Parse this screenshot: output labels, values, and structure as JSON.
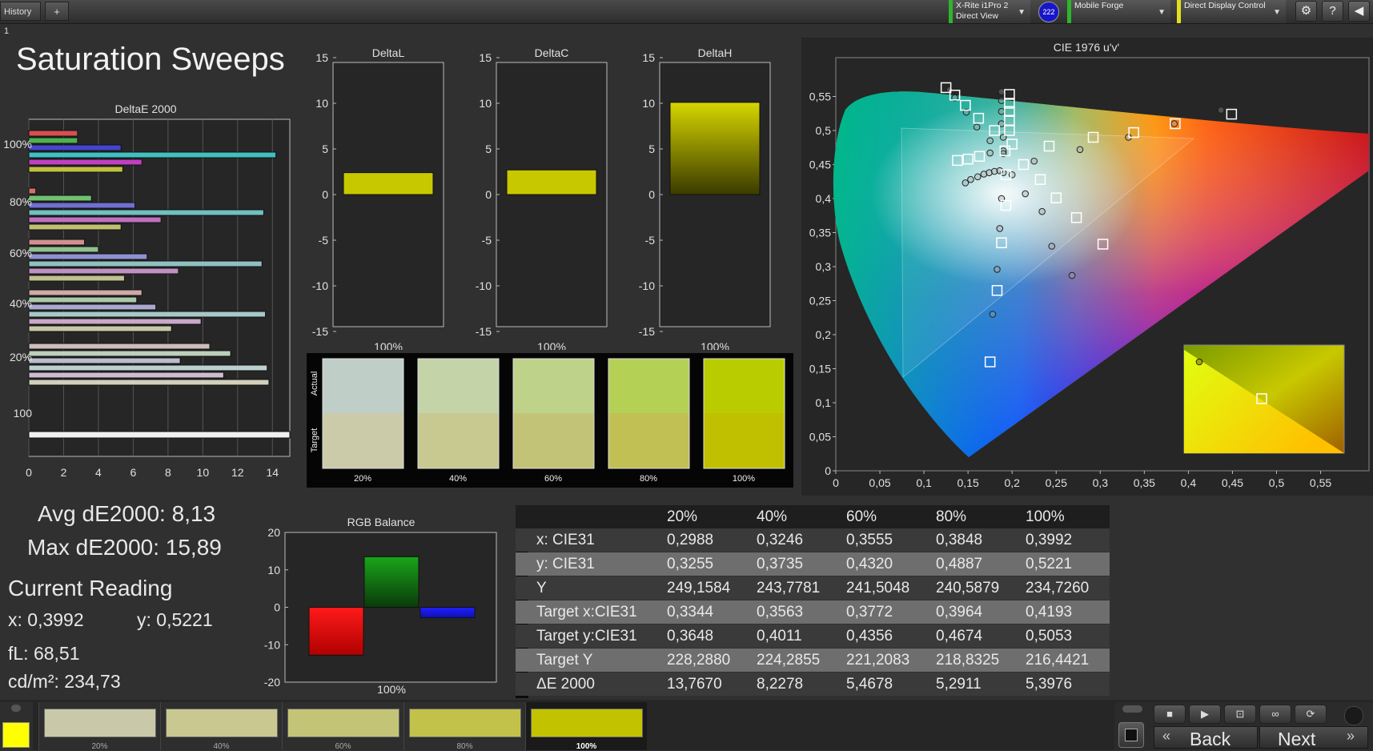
{
  "topbar": {
    "tab_label": "History 1",
    "add_tab": "+",
    "device1_line1": "X-Rite i1Pro 2",
    "device1_line2": "Direct View",
    "badge": "222",
    "device2": "Mobile Forge",
    "device3": "Direct Display Control",
    "icons": [
      "gear-icon",
      "help-icon",
      "back-icon"
    ]
  },
  "page_title": "Saturation Sweeps",
  "deltae_chart": {
    "title": "DeltaE 2000",
    "y_labels": [
      "100%",
      "80%",
      "60%",
      "40%",
      "20%",
      "100"
    ],
    "x_ticks": [
      "0",
      "2",
      "4",
      "6",
      "8",
      "10",
      "12",
      "14"
    ],
    "xlim": [
      0,
      15
    ],
    "groups": [
      {
        "label": "100%",
        "values": [
          2.8,
          2.8,
          5.3,
          14.2,
          6.5,
          5.4
        ],
        "colors": [
          "#d65050",
          "#4fb04f",
          "#4545d0",
          "#40c0c0",
          "#c040c0",
          "#c0c040"
        ]
      },
      {
        "label": "80%",
        "values": [
          0.4,
          3.6,
          6.1,
          13.5,
          7.6,
          5.3
        ],
        "colors": [
          "#d27070",
          "#70c070",
          "#7070d0",
          "#70c0c0",
          "#c070c0",
          "#c0c070"
        ]
      },
      {
        "label": "60%",
        "values": [
          3.2,
          4.0,
          6.8,
          13.4,
          8.6,
          5.5
        ],
        "colors": [
          "#d09090",
          "#90c090",
          "#9090d0",
          "#90c0c0",
          "#c090c0",
          "#c0c090"
        ]
      },
      {
        "label": "40%",
        "values": [
          6.5,
          6.2,
          7.3,
          13.6,
          9.9,
          8.2
        ],
        "colors": [
          "#d0a8a8",
          "#a8c8a8",
          "#a8a8d0",
          "#a8c8c8",
          "#c8a8c8",
          "#c8c8a8"
        ]
      },
      {
        "label": "20%",
        "values": [
          10.4,
          11.6,
          8.7,
          13.7,
          11.2,
          13.8
        ],
        "colors": [
          "#d0bcbc",
          "#bcd0bc",
          "#bcbcd0",
          "#bcd0d0",
          "#d0bcd0",
          "#d0d0bc"
        ]
      },
      {
        "label": "100",
        "values": [
          15.0
        ],
        "colors": [
          "#f0f0f0"
        ]
      }
    ]
  },
  "delta_charts": [
    {
      "title": "DeltaL",
      "value": 2.4,
      "xlabel": "100%"
    },
    {
      "title": "DeltaC",
      "value": 2.7,
      "xlabel": "100%"
    },
    {
      "title": "DeltaH",
      "value": 10.1,
      "xlabel": "100%"
    }
  ],
  "delta_axis": {
    "ticks": [
      "15",
      "10",
      "5",
      "0",
      "-5",
      "-10",
      "-15"
    ]
  },
  "swatches": {
    "actual_label": "Actual",
    "target_label": "Target",
    "items": [
      {
        "label": "20%",
        "actual": "#c0cec8",
        "target": "#cbcbaa"
      },
      {
        "label": "40%",
        "actual": "#c4d4a8",
        "target": "#c8c891"
      },
      {
        "label": "60%",
        "actual": "#bed28a",
        "target": "#c3c378"
      },
      {
        "label": "80%",
        "actual": "#b4d055",
        "target": "#c0c055"
      },
      {
        "label": "100%",
        "actual": "#b8cc00",
        "target": "#c0c000"
      }
    ]
  },
  "cie": {
    "title": "CIE 1976 u'v'",
    "x_ticks": [
      "0",
      "0,05",
      "0,1",
      "0,15",
      "0,2",
      "0,25",
      "0,3",
      "0,35",
      "0,4",
      "0,45",
      "0,5",
      "0,55"
    ],
    "y_ticks": [
      "0,55",
      "0,5",
      "0,45",
      "0,4",
      "0,35",
      "0,3",
      "0,25",
      "0,2",
      "0,15",
      "0,1",
      "0,05",
      "0"
    ],
    "targets": [
      [
        0.125,
        0.563
      ],
      [
        0.135,
        0.552
      ],
      [
        0.147,
        0.537
      ],
      [
        0.162,
        0.518
      ],
      [
        0.18,
        0.5
      ],
      [
        0.2,
        0.48
      ],
      [
        0.197,
        0.553
      ],
      [
        0.197,
        0.54
      ],
      [
        0.197,
        0.528
      ],
      [
        0.197,
        0.515
      ],
      [
        0.197,
        0.5
      ],
      [
        0.242,
        0.477
      ],
      [
        0.292,
        0.49
      ],
      [
        0.338,
        0.497
      ],
      [
        0.385,
        0.51
      ],
      [
        0.449,
        0.524
      ],
      [
        0.138,
        0.456
      ],
      [
        0.15,
        0.458
      ],
      [
        0.163,
        0.462
      ],
      [
        0.213,
        0.45
      ],
      [
        0.232,
        0.428
      ],
      [
        0.25,
        0.401
      ],
      [
        0.273,
        0.372
      ],
      [
        0.303,
        0.333
      ],
      [
        0.193,
        0.39
      ],
      [
        0.188,
        0.335
      ],
      [
        0.183,
        0.265
      ],
      [
        0.175,
        0.16
      ],
      [
        0.192,
        0.47
      ],
      [
        0.193,
        0.435
      ]
    ],
    "measured": [
      [
        0.129,
        0.56
      ],
      [
        0.135,
        0.548
      ],
      [
        0.148,
        0.527
      ],
      [
        0.16,
        0.505
      ],
      [
        0.175,
        0.485
      ],
      [
        0.188,
        0.557
      ],
      [
        0.188,
        0.544
      ],
      [
        0.188,
        0.528
      ],
      [
        0.188,
        0.51
      ],
      [
        0.19,
        0.49
      ],
      [
        0.19,
        0.47
      ],
      [
        0.225,
        0.455
      ],
      [
        0.277,
        0.472
      ],
      [
        0.332,
        0.49
      ],
      [
        0.384,
        0.51
      ],
      [
        0.437,
        0.53
      ],
      [
        0.147,
        0.423
      ],
      [
        0.153,
        0.428
      ],
      [
        0.161,
        0.432
      ],
      [
        0.168,
        0.436
      ],
      [
        0.174,
        0.438
      ],
      [
        0.18,
        0.44
      ],
      [
        0.186,
        0.441
      ],
      [
        0.19,
        0.438
      ],
      [
        0.175,
        0.467
      ],
      [
        0.19,
        0.466
      ],
      [
        0.2,
        0.435
      ],
      [
        0.215,
        0.407
      ],
      [
        0.234,
        0.381
      ],
      [
        0.245,
        0.33
      ],
      [
        0.268,
        0.287
      ],
      [
        0.188,
        0.4
      ],
      [
        0.186,
        0.356
      ],
      [
        0.183,
        0.296
      ],
      [
        0.178,
        0.23
      ]
    ],
    "inset": {
      "measured": [
        0.404,
        0.534
      ],
      "target": [
        0.419,
        0.505
      ]
    }
  },
  "stats": {
    "avg": "Avg dE2000: 8,13",
    "max": "Max dE2000: 15,89",
    "current_reading": "Current Reading",
    "x": "x: 0,3992",
    "y": "y: 0,5221",
    "fl": "fL: 68,51",
    "cdm2": "cd/m²: 234,73"
  },
  "rgb_balance": {
    "title": "RGB Balance",
    "ticks": [
      "20",
      "10",
      "0",
      "-10",
      "-20"
    ],
    "values": [
      {
        "name": "R",
        "value": -12.8,
        "color": "#ff1a1a"
      },
      {
        "name": "G",
        "value": 13.5,
        "color": "#1aa51a"
      },
      {
        "name": "B",
        "value": -2.8,
        "color": "#2020ff"
      }
    ],
    "xlabel": "100%"
  },
  "table": {
    "headers": [
      "",
      "20%",
      "40%",
      "60%",
      "80%",
      "100%"
    ],
    "rows": [
      [
        "x: CIE31",
        "0,2988",
        "0,3246",
        "0,3555",
        "0,3848",
        "0,3992"
      ],
      [
        "y: CIE31",
        "0,3255",
        "0,3735",
        "0,4320",
        "0,4887",
        "0,5221"
      ],
      [
        "Y",
        "249,1584",
        "243,7781",
        "241,5048",
        "240,5879",
        "234,7260"
      ],
      [
        "Target x:CIE31",
        "0,3344",
        "0,3563",
        "0,3772",
        "0,3964",
        "0,4193"
      ],
      [
        "Target y:CIE31",
        "0,3648",
        "0,4011",
        "0,4356",
        "0,4674",
        "0,5053"
      ],
      [
        "Target Y",
        "228,2880",
        "224,2855",
        "221,2083",
        "218,8325",
        "216,4421"
      ],
      [
        "ΔE 2000",
        "13,7670",
        "8,2278",
        "5,4678",
        "5,2911",
        "5,3976"
      ]
    ]
  },
  "bottom": {
    "patches": [
      {
        "label": "20%",
        "color": "#c9c9aa"
      },
      {
        "label": "40%",
        "color": "#c8c890"
      },
      {
        "label": "60%",
        "color": "#c4c476"
      },
      {
        "label": "80%",
        "color": "#c2c24a"
      },
      {
        "label": "100%",
        "color": "#c2c200"
      }
    ],
    "current_color": "#ffff00",
    "back_label": "Back",
    "next_label": "Next"
  }
}
